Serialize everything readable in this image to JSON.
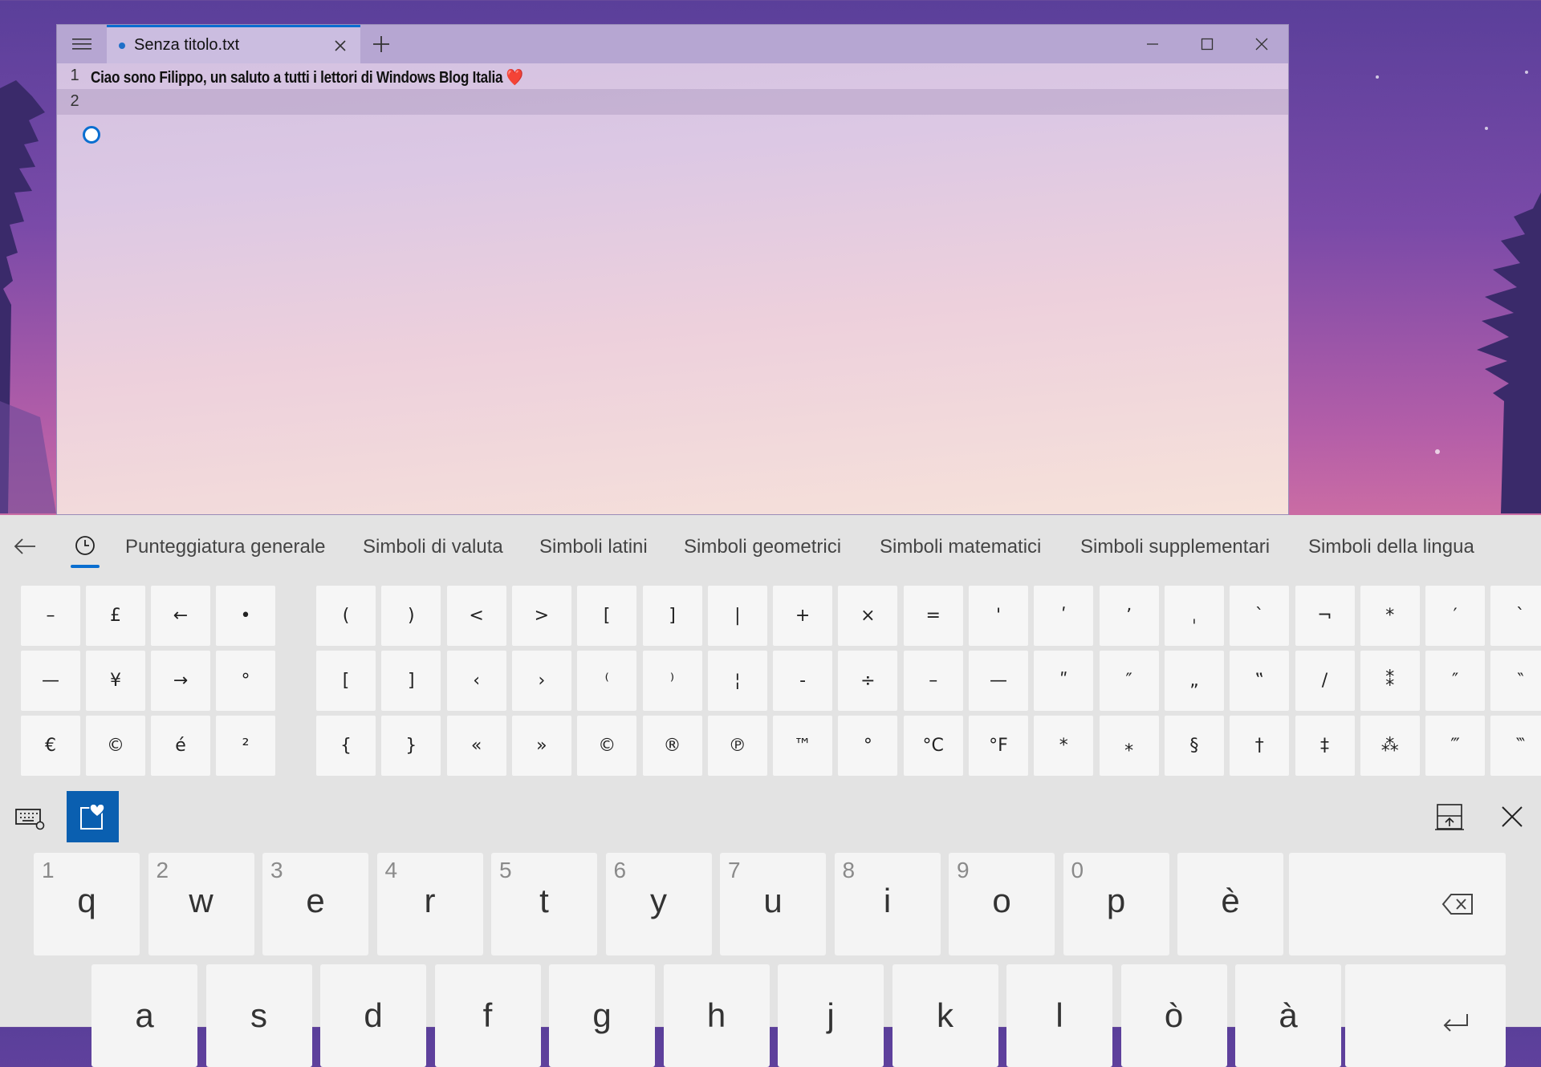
{
  "window": {
    "tab_title": "Senza titolo.txt",
    "lines": [
      {
        "number": "1",
        "text": "Ciao sono Filippo, un saluto a tutti i lettori di Windows Blog Italia"
      },
      {
        "number": "2",
        "text": ""
      }
    ],
    "heart_emoji": "❤️"
  },
  "keyboard": {
    "categories": [
      "Punteggiatura generale",
      "Simboli di valuta",
      "Simboli latini",
      "Simboli geometrici",
      "Simboli matematici",
      "Simboli supplementari",
      "Simboli della lingua"
    ],
    "recent_symbols": [
      [
        "–",
        "£",
        "←",
        "•"
      ],
      [
        "—",
        "¥",
        "→",
        "°"
      ],
      [
        "€",
        "©",
        "é",
        "²"
      ]
    ],
    "symbols": [
      [
        "(",
        ")",
        "<",
        ">",
        "[",
        "]",
        "|",
        "+",
        "×",
        "=",
        "'",
        "ʹ",
        "ʼ",
        "ˌ",
        "ˋ",
        "¬",
        "*",
        "′",
        "ˋ"
      ],
      [
        "[",
        "]",
        "‹",
        "›",
        "⁽",
        "⁾",
        "¦",
        "-",
        "÷",
        "–",
        "—",
        "ʺ",
        "″",
        "„",
        "‟",
        "/",
        "⁑",
        "″",
        "‶"
      ],
      [
        "{",
        "}",
        "«",
        "»",
        "©",
        "®",
        "℗",
        "™",
        "°",
        "°C",
        "°F",
        "*",
        "⁎",
        "§",
        "†",
        "‡",
        "⁂",
        "‴",
        "‷"
      ]
    ],
    "letters_row1": [
      {
        "num": "1",
        "ch": "q"
      },
      {
        "num": "2",
        "ch": "w"
      },
      {
        "num": "3",
        "ch": "e"
      },
      {
        "num": "4",
        "ch": "r"
      },
      {
        "num": "5",
        "ch": "t"
      },
      {
        "num": "6",
        "ch": "y"
      },
      {
        "num": "7",
        "ch": "u"
      },
      {
        "num": "8",
        "ch": "i"
      },
      {
        "num": "9",
        "ch": "o"
      },
      {
        "num": "0",
        "ch": "p"
      },
      {
        "num": "",
        "ch": "è"
      }
    ],
    "letters_row2": [
      "a",
      "s",
      "d",
      "f",
      "g",
      "h",
      "j",
      "k",
      "l",
      "ò",
      "à"
    ],
    "accent_color": "#0a6ed0"
  }
}
